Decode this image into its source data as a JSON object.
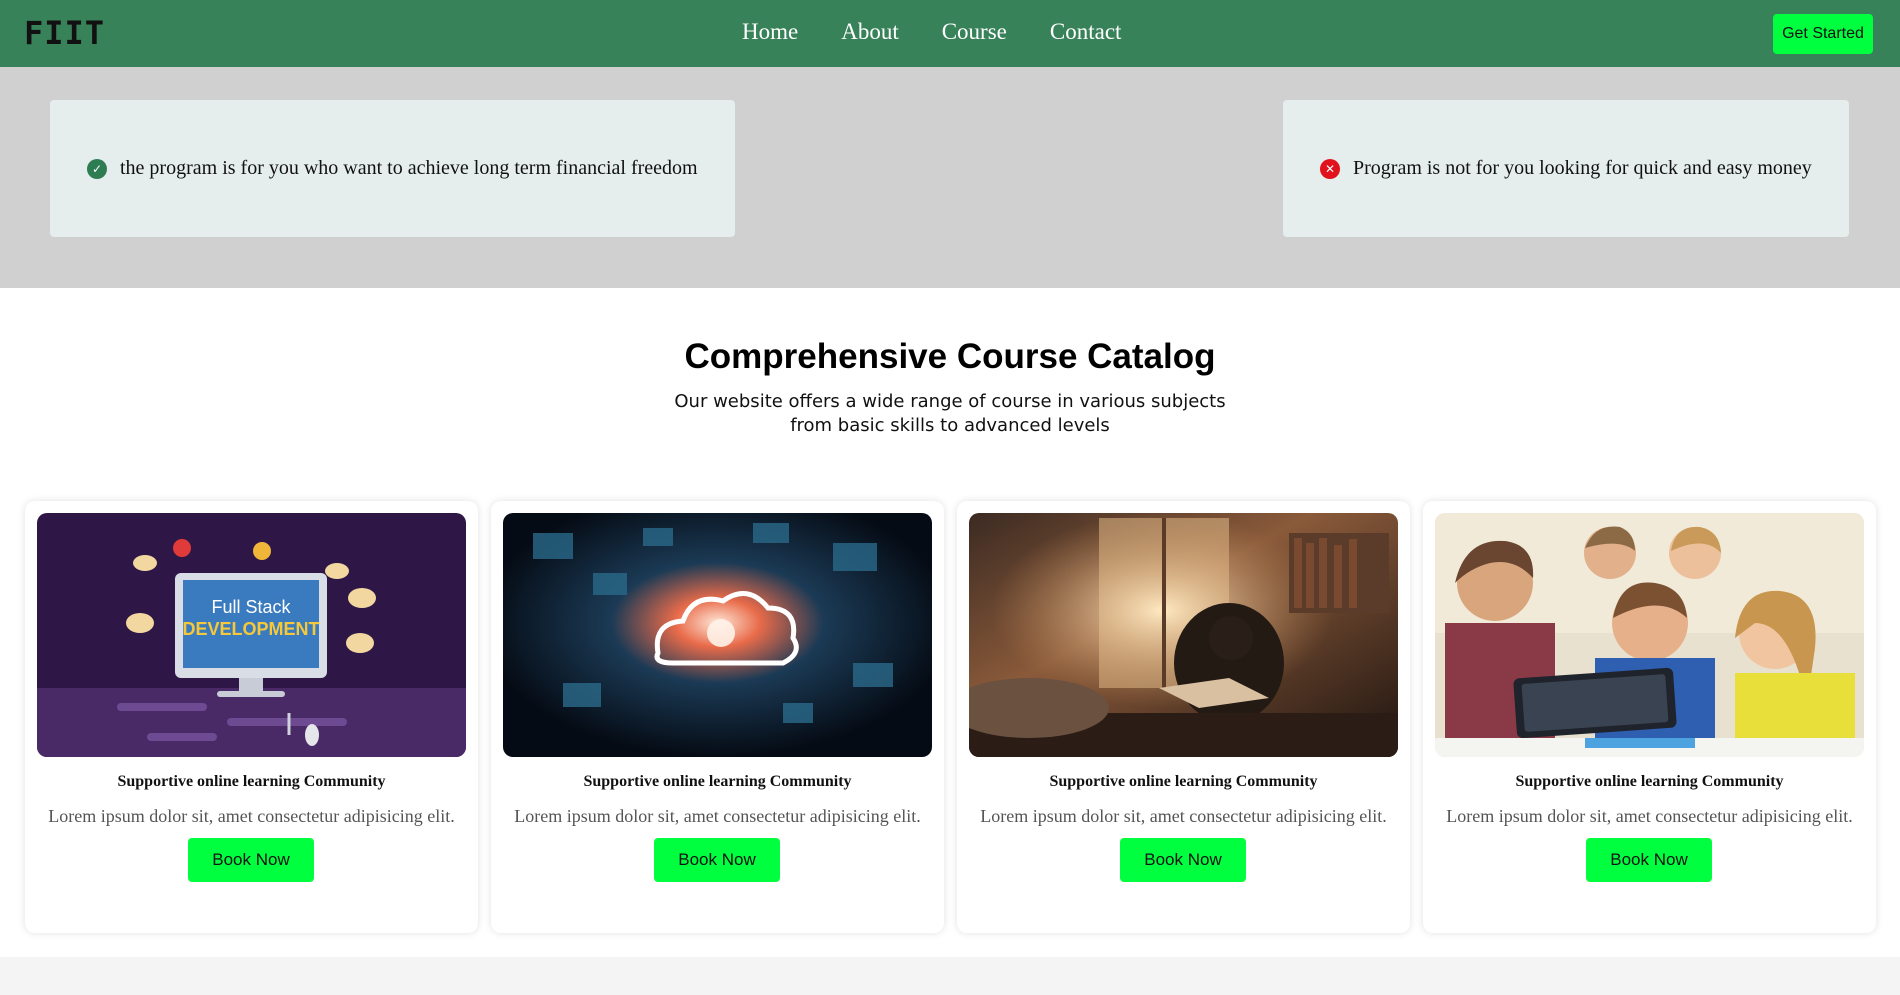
{
  "navbar": {
    "logo": "FIIT",
    "links": [
      "Home",
      "About",
      "Course",
      "Contact"
    ],
    "cta_label": "Get Started",
    "bg_color": "#38825a",
    "cta_color": "#00ff3f"
  },
  "audience": {
    "for_text": "the program is for you who want to achieve long term financial freedom",
    "not_for_text": "Program is not for you looking for quick and easy money",
    "for_icon": "check-circle-icon",
    "not_for_icon": "x-circle-icon"
  },
  "catalog": {
    "title": "Comprehensive Course Catalog",
    "subtitle_line1": "Our website offers a wide range of course in various subjects",
    "subtitle_line2": "from basic skills to advanced levels",
    "cards": [
      {
        "image_text_1": "Full Stack",
        "image_text_2": "DEVELOPMENT",
        "heading": "Supportive online learning Community",
        "description": "Lorem ipsum dolor sit, amet consectetur adipisicing elit.",
        "button": "Book Now"
      },
      {
        "heading": "Supportive online learning Community",
        "description": "Lorem ipsum dolor sit, amet consectetur adipisicing elit.",
        "button": "Book Now"
      },
      {
        "heading": "Supportive online learning Community",
        "description": "Lorem ipsum dolor sit, amet consectetur adipisicing elit.",
        "button": "Book Now"
      },
      {
        "heading": "Supportive online learning Community",
        "description": "Lorem ipsum dolor sit, amet consectetur adipisicing elit.",
        "button": "Book Now"
      }
    ]
  }
}
